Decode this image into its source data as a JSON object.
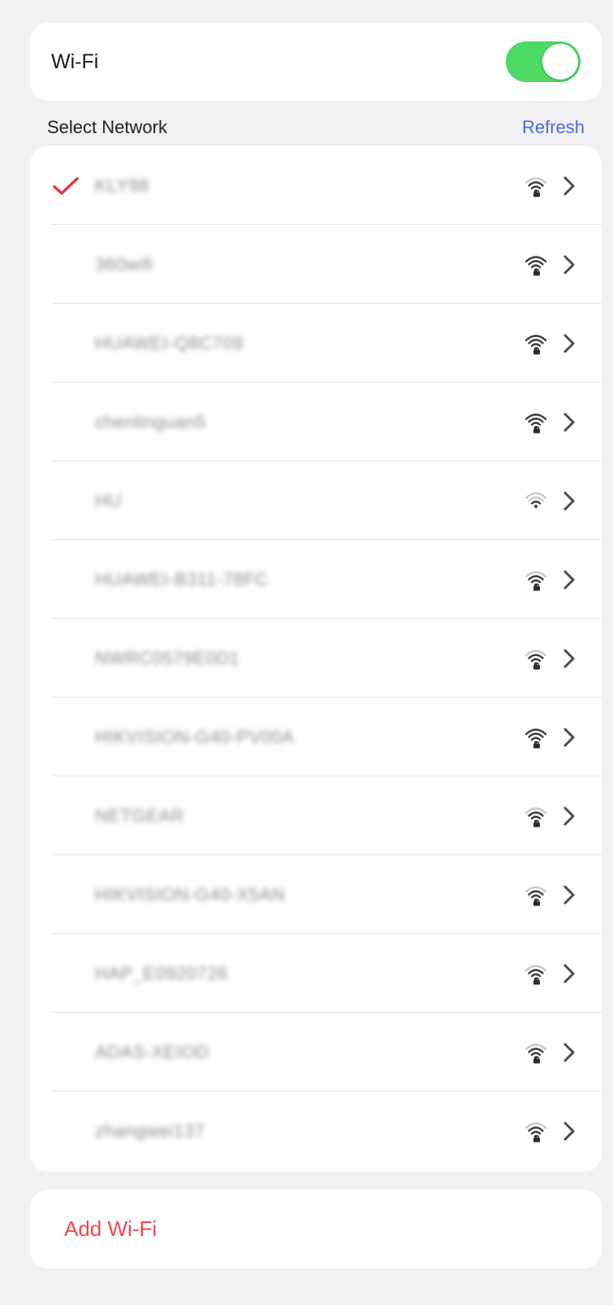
{
  "wifi": {
    "label": "Wi-Fi",
    "enabled": true
  },
  "networks_header": {
    "title": "Select Network",
    "refresh_label": "Refresh"
  },
  "networks": [
    {
      "name": "KLY98",
      "connected": true,
      "signal": 3,
      "icon": "wifi-locked-icon"
    },
    {
      "name": "360wifi",
      "connected": false,
      "signal": 4,
      "icon": "wifi-locked-icon"
    },
    {
      "name": "HUAWEI-Q8C709",
      "connected": false,
      "signal": 4,
      "icon": "wifi-locked-icon"
    },
    {
      "name": "chenlinguan5",
      "connected": false,
      "signal": 4,
      "icon": "wifi-locked-icon"
    },
    {
      "name": "HU",
      "connected": false,
      "signal": 2,
      "icon": "wifi-icon"
    },
    {
      "name": "HUAWEI-B311-78FC",
      "connected": false,
      "signal": 3,
      "icon": "wifi-locked-icon"
    },
    {
      "name": "NWRC0579E0D1",
      "connected": false,
      "signal": 3,
      "icon": "wifi-locked-icon"
    },
    {
      "name": "HIKVISION-G40-PV00A",
      "connected": false,
      "signal": 4,
      "icon": "wifi-locked-icon"
    },
    {
      "name": "NETGEAR",
      "connected": false,
      "signal": 3,
      "icon": "wifi-locked-icon"
    },
    {
      "name": "HIKVISION-G40-X5AN",
      "connected": false,
      "signal": 3,
      "icon": "wifi-locked-icon"
    },
    {
      "name": "HAP_E0920726",
      "connected": false,
      "signal": 3,
      "icon": "wifi-locked-icon"
    },
    {
      "name": "ADAS-XEIOD",
      "connected": false,
      "signal": 3,
      "icon": "wifi-locked-icon"
    },
    {
      "name": "zhangwei137",
      "connected": false,
      "signal": 3,
      "icon": "wifi-locked-icon"
    }
  ],
  "add_wifi": {
    "label": "Add Wi-Fi"
  },
  "colors": {
    "toggle_on": "#4cd964",
    "refresh": "#4a69e0",
    "check": "#e8343f",
    "add_wifi": "#f0464f",
    "chevron": "#4a4a4a"
  }
}
